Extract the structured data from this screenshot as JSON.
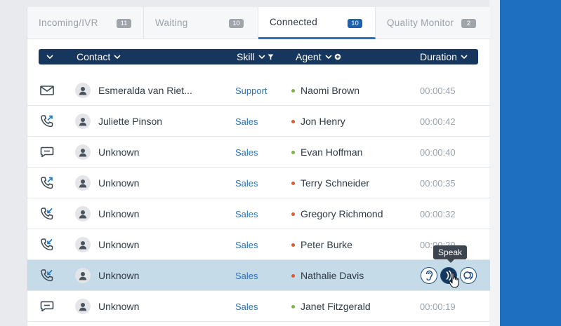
{
  "tabs": [
    {
      "label": "Incoming/IVR",
      "count": "11",
      "active": false
    },
    {
      "label": "Waiting",
      "count": "10",
      "active": false
    },
    {
      "label": "Connected",
      "count": "10",
      "active": true
    },
    {
      "label": "Quality Monitor",
      "count": "2",
      "active": false
    }
  ],
  "columns": {
    "contact": "Contact",
    "skill": "Skill",
    "agent": "Agent",
    "duration": "Duration"
  },
  "colors": {
    "accent": "#1b75c4",
    "header": "#17365d",
    "status_available": "#7cb342",
    "status_busy": "#e5582a",
    "selected_row": "#c5dbe8"
  },
  "rows": [
    {
      "type_icon": "email-icon",
      "contact": "Esmeralda van Riet...",
      "skill": "Support",
      "agent": "Naomi Brown",
      "agent_status": "available",
      "duration": "00:00:45"
    },
    {
      "type_icon": "outbound-call-icon",
      "contact": "Juliette Pinson",
      "skill": "Sales",
      "agent": "Jon Henry",
      "agent_status": "busy",
      "duration": "00:00:42"
    },
    {
      "type_icon": "chat-icon",
      "contact": "Unknown",
      "skill": "Sales",
      "agent": "Evan Hoffman",
      "agent_status": "available",
      "duration": "00:00:40"
    },
    {
      "type_icon": "outbound-call-icon",
      "contact": "Unknown",
      "skill": "Sales",
      "agent": "Terry Schneider",
      "agent_status": "busy",
      "duration": "00:00:35"
    },
    {
      "type_icon": "inbound-call-icon",
      "contact": "Unknown",
      "skill": "Sales",
      "agent": "Gregory Richmond",
      "agent_status": "busy",
      "duration": "00:00:32"
    },
    {
      "type_icon": "inbound-call-icon",
      "contact": "Unknown",
      "skill": "Sales",
      "agent": "Peter Burke",
      "agent_status": "busy",
      "duration": "00:00:29"
    },
    {
      "type_icon": "inbound-call-icon",
      "contact": "Unknown",
      "skill": "Sales",
      "agent": "Nathalie Davis",
      "agent_status": "busy",
      "duration": "",
      "selected": true,
      "actions": [
        {
          "name": "listen-icon"
        },
        {
          "name": "speak-icon"
        },
        {
          "name": "barge-icon"
        }
      ]
    },
    {
      "type_icon": "chat-icon",
      "contact": "Unknown",
      "skill": "Sales",
      "agent": "Janet Fitzgerald",
      "agent_status": "available",
      "duration": "00:00:19"
    }
  ],
  "tooltip": "Speak"
}
